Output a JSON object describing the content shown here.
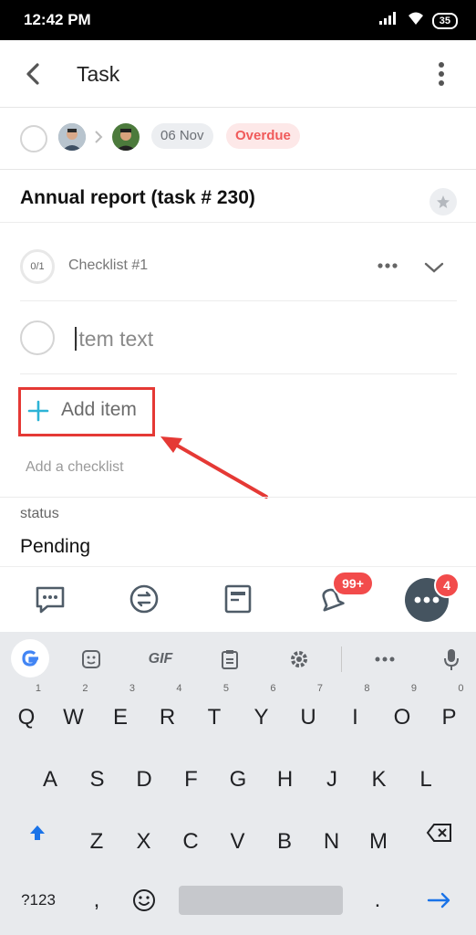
{
  "status_bar": {
    "time": "12:42 PM",
    "battery": "35"
  },
  "header": {
    "title": "Task"
  },
  "meta": {
    "date": "06 Nov",
    "status_badge": "Overdue"
  },
  "task": {
    "title": "Annual report (task # 230)"
  },
  "checklist": {
    "progress": "0/1",
    "name": "Checklist #1",
    "item_placeholder": "Item text",
    "add_item_label": "Add item",
    "add_checklist_label": "Add a checklist"
  },
  "field": {
    "label": "status",
    "value": "Pending"
  },
  "taskbar": {
    "notif_badge": "99+",
    "more_badge": "4"
  },
  "keyboard": {
    "gif_label": "GIF",
    "row1": [
      {
        "k": "Q",
        "n": "1"
      },
      {
        "k": "W",
        "n": "2"
      },
      {
        "k": "E",
        "n": "3"
      },
      {
        "k": "R",
        "n": "4"
      },
      {
        "k": "T",
        "n": "5"
      },
      {
        "k": "Y",
        "n": "6"
      },
      {
        "k": "U",
        "n": "7"
      },
      {
        "k": "I",
        "n": "8"
      },
      {
        "k": "O",
        "n": "9"
      },
      {
        "k": "P",
        "n": "0"
      }
    ],
    "row2": [
      "A",
      "S",
      "D",
      "F",
      "G",
      "H",
      "J",
      "K",
      "L"
    ],
    "row3": [
      "Z",
      "X",
      "C",
      "V",
      "B",
      "N",
      "M"
    ],
    "sym_label": "?123",
    "comma": ",",
    "period": "."
  },
  "colors": {
    "accent": "#2db3d6",
    "overdue": "#f05a5a",
    "highlight": "#e53935"
  }
}
